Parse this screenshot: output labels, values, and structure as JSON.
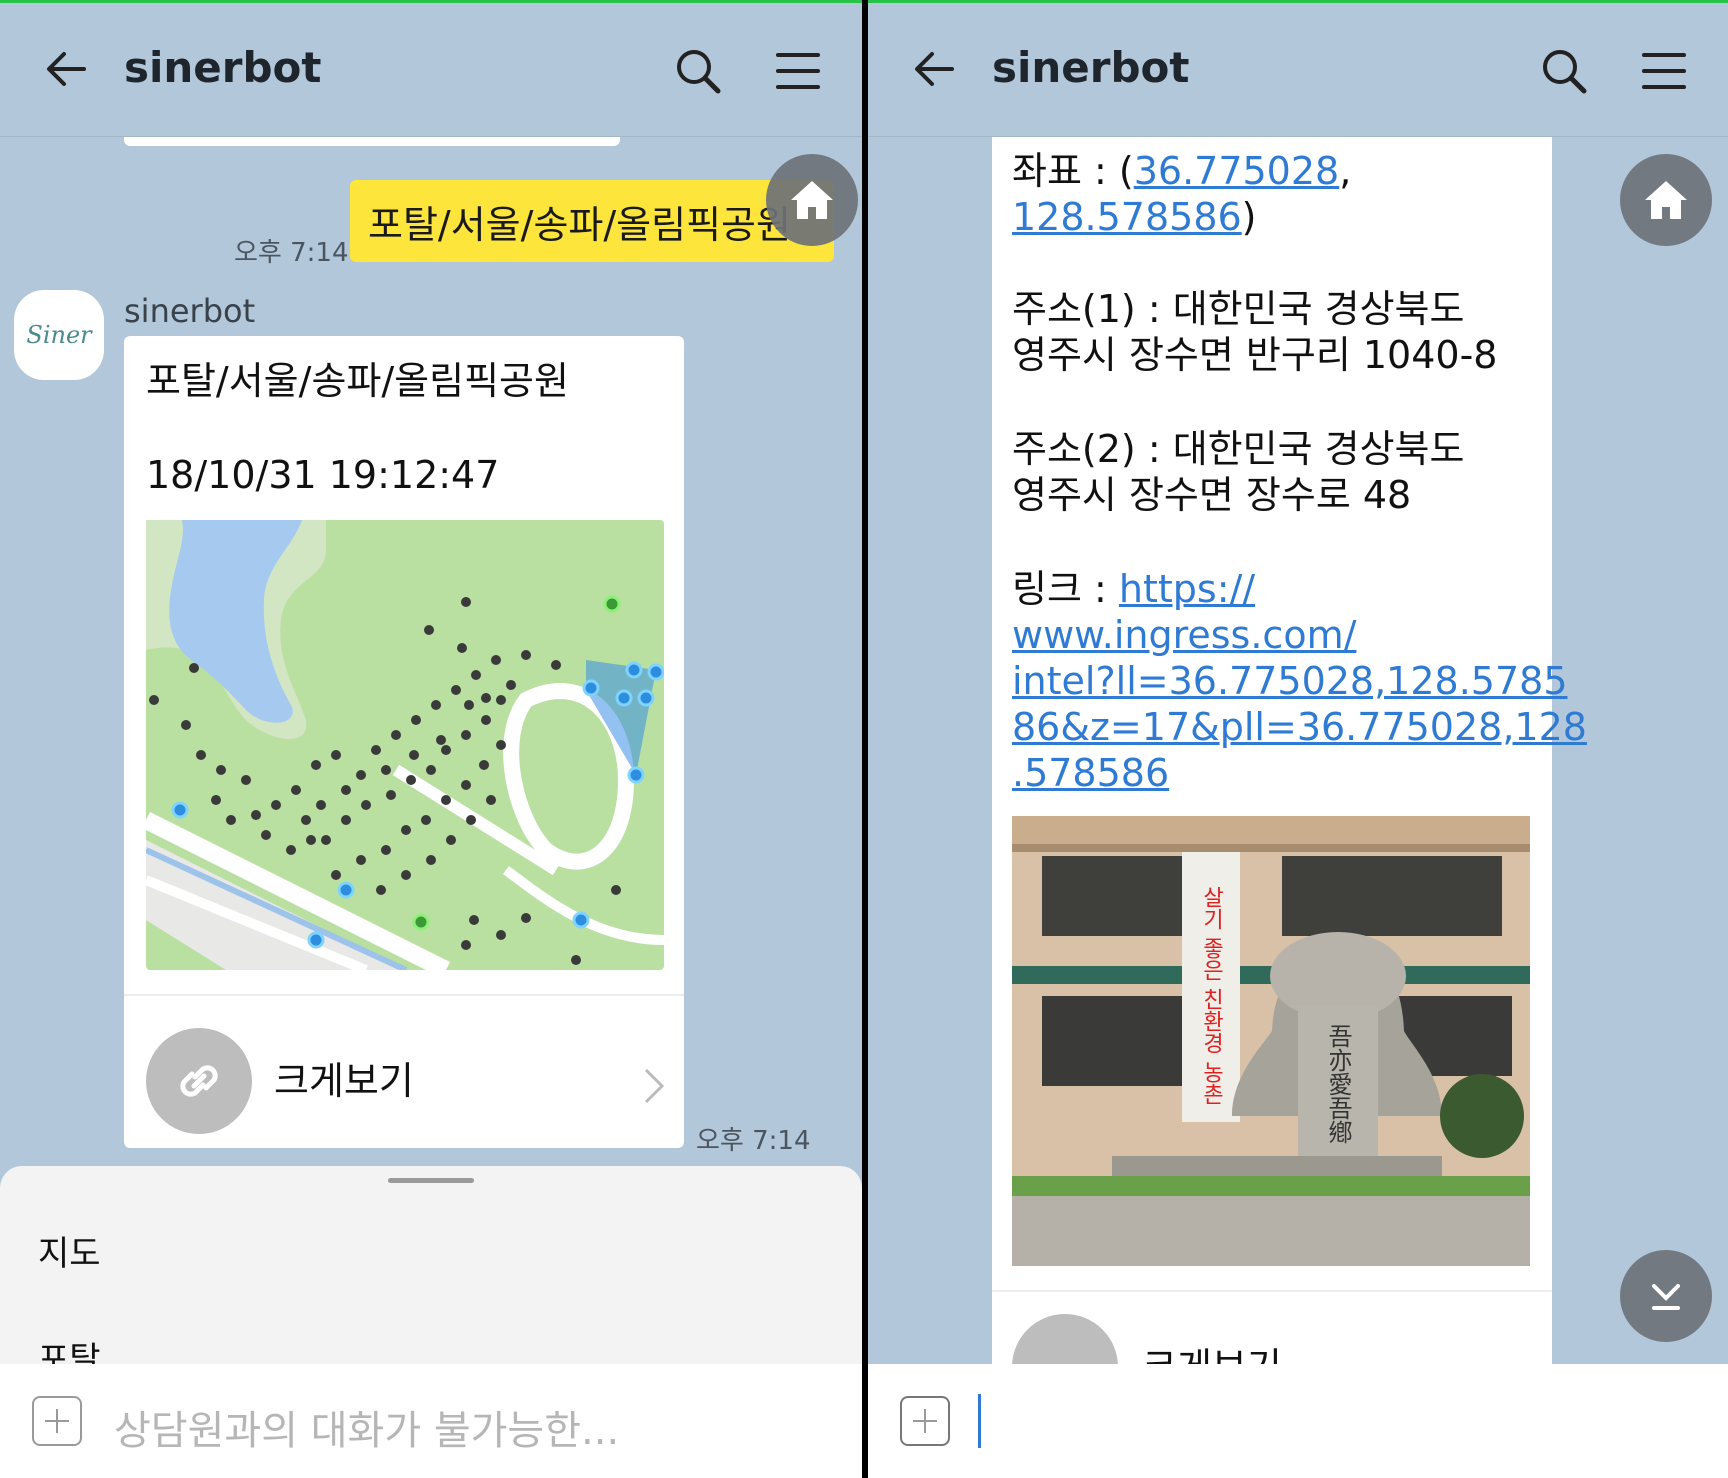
{
  "left": {
    "header": {
      "title": "sinerbot"
    },
    "sent_message": {
      "text": "포탈/서울/송파/올림픽공원",
      "time": "오후 7:14"
    },
    "bot_message": {
      "sender": "sinerbot",
      "avatar_text": "Siner",
      "title": "포탈/서울/송파/올림픽공원",
      "datetime": "18/10/31 19:12:47",
      "link_label": "크게보기",
      "time": "오후 7:14"
    },
    "sheet": {
      "items": [
        "지도",
        "포탈"
      ]
    },
    "input": {
      "placeholder": "상담원과의 대화가 불가능한..."
    }
  },
  "right": {
    "header": {
      "title": "sinerbot"
    },
    "coords": {
      "label": "좌표 : (",
      "lat": "36.775028",
      "comma": ",",
      "lng": "128.578586",
      "close": ")"
    },
    "address1": {
      "line1": "주소(1) : 대한민국 경상북도",
      "line2": "영주시 장수면 반구리 1040-8"
    },
    "address2": {
      "line1": "주소(2) : 대한민국 경상북도",
      "line2": "영주시 장수면 장수로 48"
    },
    "link": {
      "label": "링크 : ",
      "url_lines": [
        "https://",
        "www.ingress.com/",
        "intel?ll=36.775028,128.5785",
        "86&z=17&pll=36.775028,128",
        ".578586"
      ]
    },
    "photo": {
      "banner_text": "살기 좋은 친환경 농촌",
      "stone_text": "吾亦愛吾鄕"
    },
    "link_label": "크게보기"
  }
}
